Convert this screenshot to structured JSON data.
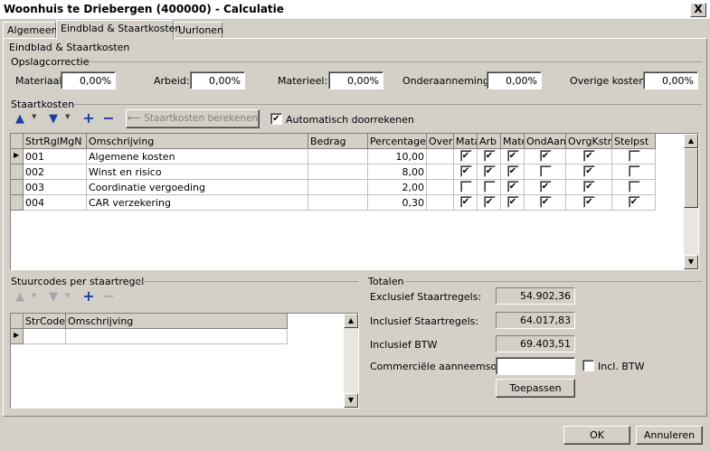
{
  "window": {
    "title": "Woonhuis te Driebergen (400000) - Calculatie",
    "close": "X"
  },
  "tabs": [
    "Algemeen",
    "Eindblad & Staartkosten",
    "Uurlonen"
  ],
  "panel_title": "Eindblad & Staartkosten",
  "opslag": {
    "title": "Opslagcorrectie",
    "materiaal_label": "Materiaal:",
    "materiaal": "0,00%",
    "arbeid_label": "Arbeid:",
    "arbeid": "0,00%",
    "materieel_label": "Materieel:",
    "materieel": "0,00%",
    "onderaanneming_label": "Onderaanneming:",
    "onderaanneming": "0,00%",
    "overige_label": "Overige kosten:",
    "overige": "0,00%"
  },
  "staart": {
    "title": "Staartkosten",
    "berekenen": "Staartkosten berekenen",
    "auto_label": "Automatisch doorrekenen",
    "auto_checked": true,
    "columns": [
      "StrtRglMgN",
      "Omschrijving",
      "Bedrag",
      "Percentage",
      "Over",
      "Mata",
      "Arb",
      "Mate",
      "OndAan",
      "OvrgKstn",
      "Stelpst"
    ],
    "rows": [
      {
        "code": "001",
        "omschrijving": "Algemene kosten",
        "bedrag": "",
        "percentage": "10,00",
        "checks": [
          true,
          true,
          true,
          true,
          true,
          false
        ]
      },
      {
        "code": "002",
        "omschrijving": "Winst en risico",
        "bedrag": "",
        "percentage": "8,00",
        "checks": [
          true,
          true,
          true,
          false,
          true,
          false
        ]
      },
      {
        "code": "003",
        "omschrijving": "Coordinatie vergoeding",
        "bedrag": "",
        "percentage": "2,00",
        "checks": [
          false,
          false,
          true,
          true,
          true,
          false
        ]
      },
      {
        "code": "004",
        "omschrijving": "CAR verzekering",
        "bedrag": "",
        "percentage": "0,30",
        "checks": [
          true,
          true,
          true,
          true,
          true,
          true
        ]
      }
    ]
  },
  "stuur": {
    "title": "Stuurcodes per staartregel",
    "columns": [
      "StrCode",
      "Omschrijving"
    ]
  },
  "totalen": {
    "title": "Totalen",
    "excl_label": "Exclusief Staartregels:",
    "excl": "54.902,36",
    "incl_label": "Inclusief Staartregels:",
    "incl": "64.017,83",
    "btw_label": "Inclusief BTW",
    "btw": "69.403,51",
    "aanneem_label": "Commerciële aanneemsom:",
    "aanneem": "",
    "incl_btw_label": "Incl. BTW",
    "toepassen": "Toepassen"
  },
  "footer": {
    "ok": "OK",
    "annuleren": "Annuleren"
  }
}
